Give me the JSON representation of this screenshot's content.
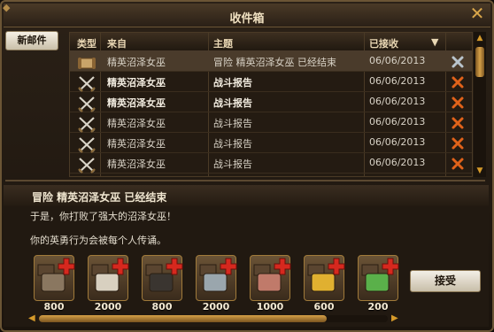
{
  "window": {
    "title": "收件箱",
    "close_icon": "close-x-icon"
  },
  "sidebar": {
    "new_mail_label": "新邮件"
  },
  "list": {
    "columns": [
      "类型",
      "来自",
      "主题",
      "已接收"
    ],
    "rows": [
      {
        "type_icon": "scroll-icon",
        "from": "精英沼泽女巫",
        "subject": "冒险 精英沼泽女巫 已经结束",
        "date": "06/06/2013",
        "bold": false,
        "selected": true
      },
      {
        "type_icon": "crossed-swords-icon",
        "from": "精英沼泽女巫",
        "subject": "战斗报告",
        "date": "06/06/2013",
        "bold": true,
        "selected": false
      },
      {
        "type_icon": "crossed-swords-icon",
        "from": "精英沼泽女巫",
        "subject": "战斗报告",
        "date": "06/06/2013",
        "bold": true,
        "selected": false
      },
      {
        "type_icon": "crossed-swords-icon",
        "from": "精英沼泽女巫",
        "subject": "战斗报告",
        "date": "06/06/2013",
        "bold": false,
        "selected": false
      },
      {
        "type_icon": "crossed-swords-icon",
        "from": "精英沼泽女巫",
        "subject": "战斗报告",
        "date": "06/06/2013",
        "bold": false,
        "selected": false
      },
      {
        "type_icon": "crossed-swords-icon",
        "from": "精英沼泽女巫",
        "subject": "战斗报告",
        "date": "06/06/2013",
        "bold": false,
        "selected": false
      }
    ]
  },
  "message": {
    "header": "冒险 精英沼泽女巫 已经结束",
    "lines": [
      "于是，你打败了强大的沼泽女巫！",
      "你的英勇行为会被每个人传诵。"
    ],
    "rewards": [
      {
        "icon": "stone-resource-icon",
        "amount": "800"
      },
      {
        "icon": "marble-resource-icon",
        "amount": "2000"
      },
      {
        "icon": "coal-resource-icon",
        "amount": "800"
      },
      {
        "icon": "iron-sword-resource-icon",
        "amount": "2000"
      },
      {
        "icon": "sausage-resource-icon",
        "amount": "1000"
      },
      {
        "icon": "gold-coin-resource-icon",
        "amount": "600"
      },
      {
        "icon": "green-gem-resource-icon",
        "amount": "200"
      }
    ],
    "accept_label": "接受"
  },
  "colors": {
    "accent": "#d59a2a",
    "delete_active": "#e0621a",
    "delete_inactive": "#b9c4cc"
  }
}
